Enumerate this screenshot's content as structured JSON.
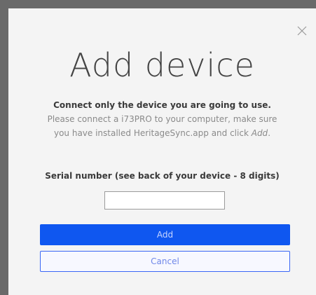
{
  "dialog": {
    "title": "Add device",
    "close_icon": "close-icon",
    "instruction_strong": "Connect only the device you are going to use.",
    "instruction_text": "Please connect a i73PRO to your computer, make sure you have installed HeritageSync.app and click",
    "instruction_add": "Add",
    "instruction_period": ".",
    "serial_label": "Serial number (see back of your device - 8 digits)",
    "serial_value": "",
    "add_label": "Add",
    "cancel_label": "Cancel"
  },
  "colors": {
    "primary": "#0f57f0",
    "primary_text": "#c7d5ff",
    "cancel_border": "#3a67f5",
    "cancel_text": "#6f87e9"
  }
}
